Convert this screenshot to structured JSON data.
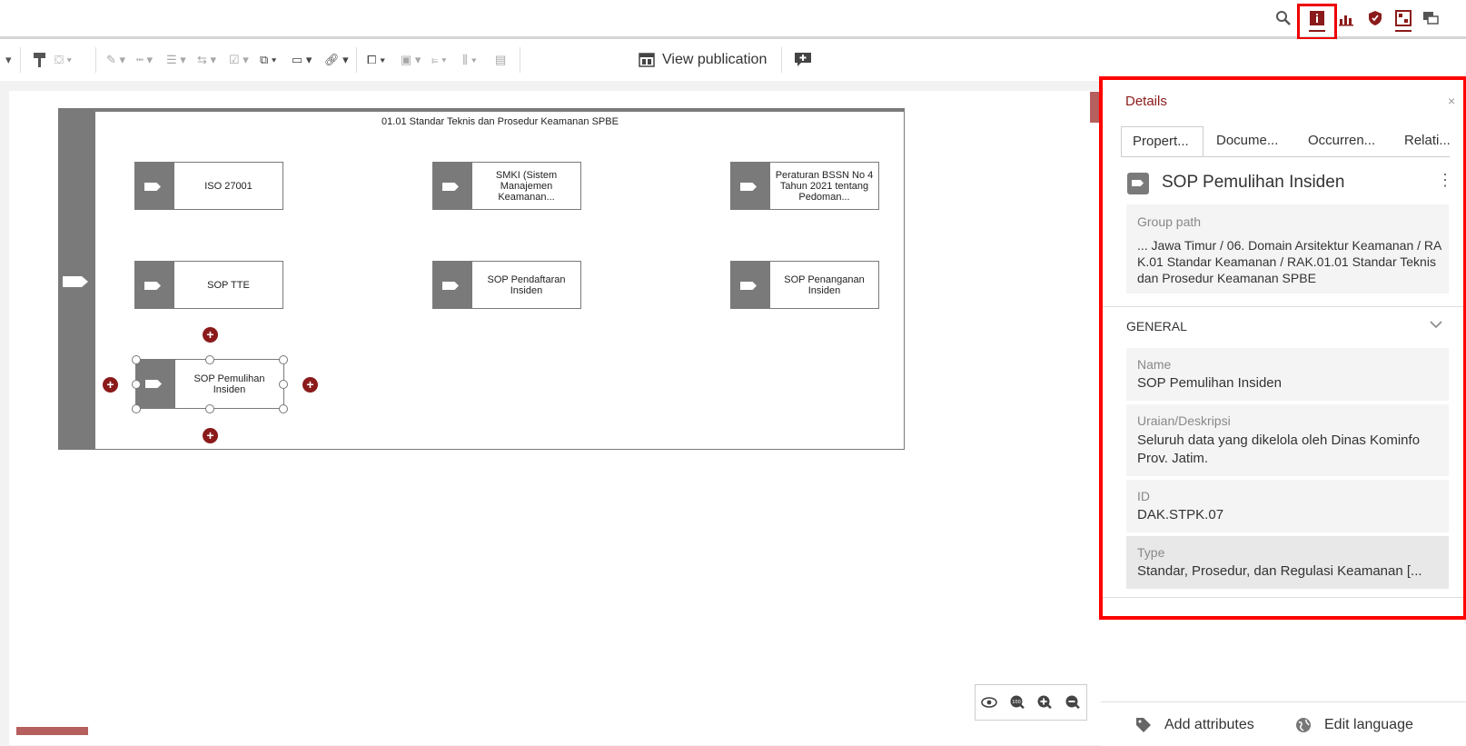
{
  "topbar": {
    "icons": [
      "search-icon",
      "info-icon",
      "chart-icon",
      "shield-icon",
      "model-icon",
      "comments-icon"
    ]
  },
  "toolbar": {
    "view_publication_label": "View publication"
  },
  "diagram": {
    "lane_title": "01.01 Standar Teknis dan Prosedur Keamanan SPBE",
    "nodes": [
      {
        "label": "ISO 27001"
      },
      {
        "label": "SMKI (Sistem Manajemen Keamanan..."
      },
      {
        "label": "Peraturan BSSN No 4 Tahun 2021 tentang Pedoman..."
      },
      {
        "label": "SOP TTE"
      },
      {
        "label": "SOP Pendaftaran Insiden"
      },
      {
        "label": "SOP Penanganan Insiden"
      },
      {
        "label": "SOP Pemulihan Insiden"
      }
    ]
  },
  "details": {
    "title": "Details",
    "close": "×",
    "tabs": [
      "Propert...",
      "Docume...",
      "Occurren...",
      "Relati..."
    ],
    "object_name": "SOP Pemulihan Insiden",
    "more": "⋮",
    "group_path_label": "Group path",
    "group_path_value": "... Jawa Timur / 06. Domain Arsitektur Keamanan / RAK.01 Standar Keamanan / RAK.01.01 Standar Teknis dan Prosedur Keamanan SPBE",
    "section_label": "GENERAL",
    "props": [
      {
        "label": "Name",
        "value": "SOP Pemulihan Insiden"
      },
      {
        "label": "Uraian/Deskripsi",
        "value": "Seluruh data yang dikelola oleh Dinas Kominfo Prov. Jatim."
      },
      {
        "label": "ID",
        "value": "DAK.STPK.07"
      },
      {
        "label": "Type",
        "value": "Standar, Prosedur, dan Regulasi Keamanan [..."
      }
    ],
    "footer": {
      "add_attributes": "Add attributes",
      "edit_language": "Edit language"
    }
  },
  "colors": {
    "accent": "#8b1a1a",
    "highlight": "#ff0000",
    "shape_gray": "#7a7a7a"
  }
}
